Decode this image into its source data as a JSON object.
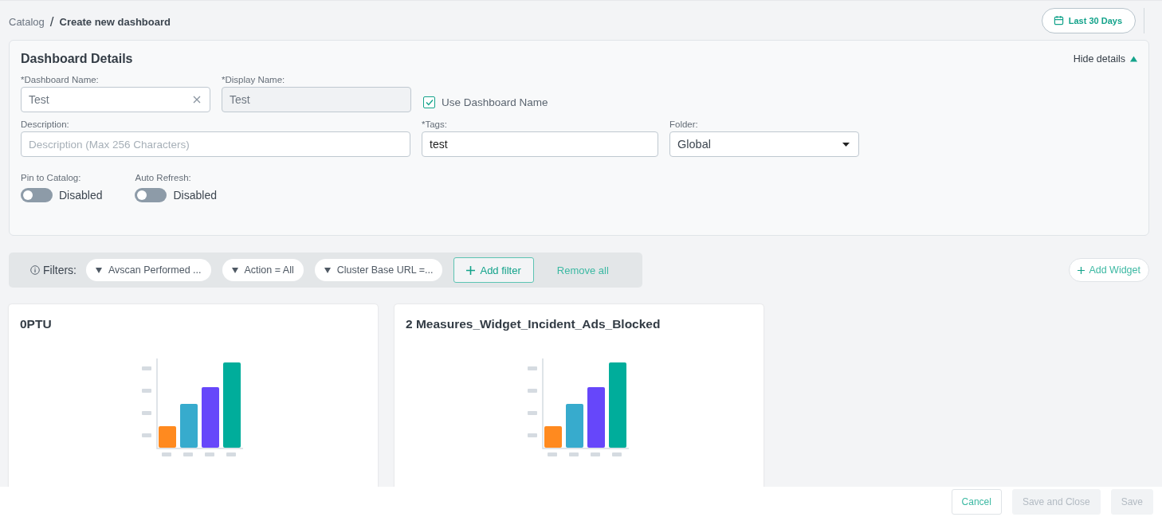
{
  "breadcrumb": [
    {
      "label": "Catalog",
      "current": false
    },
    {
      "label": "Create new dashboard",
      "current": true
    }
  ],
  "breadcrumb_separator": "/",
  "date_range": {
    "label": "Last 30 Days"
  },
  "details": {
    "title": "Dashboard Details",
    "toggle_label": "Hide details",
    "expanded": true,
    "dashboard_name": {
      "label": "*Dashboard Name:",
      "value": "Test",
      "disabled": false
    },
    "display_name": {
      "label": "*Display Name:",
      "value": "Test",
      "disabled": true
    },
    "use_dashboard_name": {
      "label": "Use Dashboard Name",
      "checked": true
    },
    "description": {
      "label": "Description:",
      "placeholder": "Description (Max 256 Characters)"
    },
    "tags": {
      "label": "*Tags:",
      "value": "test"
    },
    "folder": {
      "label": "Folder:",
      "value": "Global"
    },
    "switches": [
      {
        "label": "Pin to Catalog:",
        "state_text": "Disabled",
        "on": false
      },
      {
        "label": "Auto Refresh:",
        "state_text": "Disabled",
        "on": false
      }
    ]
  },
  "filters": {
    "label": "Filters:",
    "chips": [
      "Avscan Performed ...",
      "Action = All",
      "Cluster Base URL =..."
    ],
    "add_label": "Add filter",
    "remove_label": "Remove all"
  },
  "add_widget": {
    "label": "Add Widget"
  },
  "widgets": [
    {
      "title": "0PTU"
    },
    {
      "title": "2 Measures_Widget_Incident_Ads_Blocked"
    }
  ],
  "footer": [
    {
      "label": "Cancel",
      "disabled": false
    },
    {
      "label": "Save and Close",
      "disabled": true
    },
    {
      "label": "Save",
      "disabled": true
    }
  ]
}
